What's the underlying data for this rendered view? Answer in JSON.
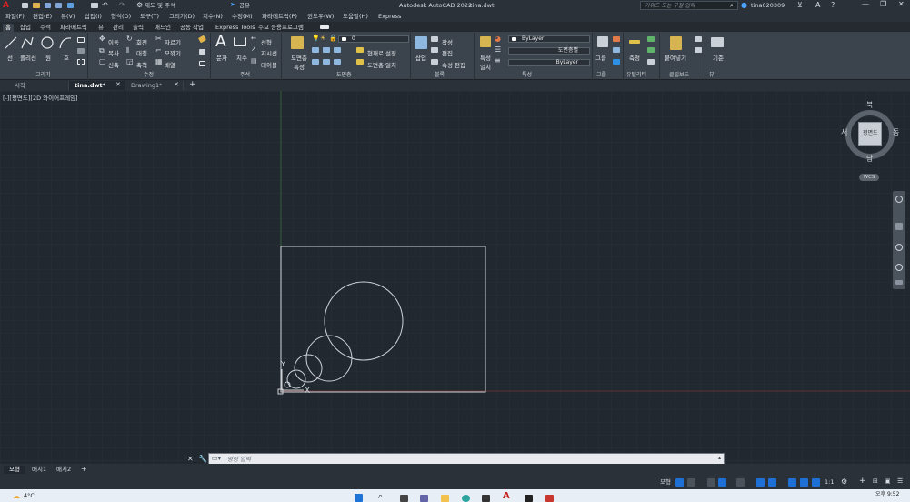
{
  "title": {
    "app_title": "Autodesk AutoCAD 2022",
    "file_name": "tina.dwt",
    "search_placeholder": "키워드 또는 구절 입력",
    "user": "tina020309",
    "workspace": "제도 및 주석",
    "share": "공유"
  },
  "menu": [
    "파일(F)",
    "편집(E)",
    "뷰(V)",
    "삽입(I)",
    "형식(O)",
    "도구(T)",
    "그리기(D)",
    "치수(N)",
    "수정(M)",
    "파라메트릭(P)",
    "윈도우(W)",
    "도움말(H)",
    "Express"
  ],
  "ribbon_tabs": [
    "홈",
    "삽입",
    "주석",
    "파라메트릭",
    "뷰",
    "관리",
    "출력",
    "애드인",
    "공동 작업",
    "Express Tools",
    "주요 응용프로그램"
  ],
  "ribbon": {
    "draw": {
      "line": "선",
      "polyline": "폴리선",
      "circle": "원",
      "arc": "호",
      "panel": "그리기"
    },
    "modify": {
      "move": "이동",
      "rotate": "회전",
      "trim": "자르기",
      "copy": "복사",
      "mirror": "대칭",
      "fillet": "모깎기",
      "stretch": "신축",
      "scale": "축척",
      "array": "배열",
      "panel": "수정"
    },
    "annotation": {
      "text": "문자",
      "dimension": "치수",
      "linear": "선형",
      "leader": "지시선",
      "table": "테이블",
      "panel": "주석"
    },
    "layers": {
      "props": "도면층 특성",
      "current_layer": "0",
      "make_current": "현재로 설정",
      "match": "도면층 일치",
      "panel": "도면층"
    },
    "block": {
      "insert": "삽입",
      "create": "작성",
      "edit": "편집",
      "attr_edit": "속성 편집",
      "panel": "블록"
    },
    "properties": {
      "match": "특성 일치",
      "color": "ByLayer",
      "linetype": "도면층별",
      "lineweight": "ByLayer",
      "panel": "특성"
    },
    "groups": {
      "group": "그룹",
      "panel": "그룹"
    },
    "utilities": {
      "measure": "측정",
      "panel": "유틸리티"
    },
    "clipboard": {
      "paste": "붙여넣기",
      "panel": "클립보드"
    },
    "view": {
      "base": "기준",
      "panel": "뷰"
    }
  },
  "doc_tabs": [
    "시작",
    "tina.dwt*",
    "Drawing1*"
  ],
  "viewport_label": "[-][평면도][2D 와이어프레임]",
  "viewcube": {
    "north": "북",
    "south": "남",
    "east": "동",
    "west": "서",
    "face": "평면도",
    "wcs": "WCS"
  },
  "command_placeholder": "명령 입력",
  "layout_tabs": [
    "모형",
    "배치1",
    "배치2"
  ],
  "status": {
    "model": "모형",
    "scale": "1:1"
  },
  "taskbar": {
    "weather": "4°C",
    "time": "오후 9:52"
  }
}
